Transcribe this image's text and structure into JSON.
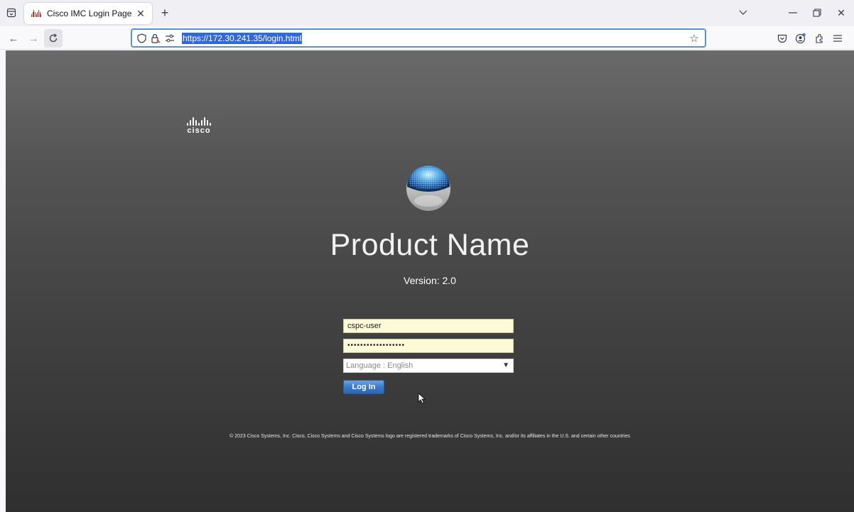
{
  "browser": {
    "tab_title": "Cisco IMC Login Page",
    "url": "https://172.30.241.35/login.html"
  },
  "page": {
    "logo_text": "cisco",
    "product_name": "Product Name",
    "version": "Version: 2.0",
    "username_value": "cspc-user",
    "password_value": "••••••••••••••••••",
    "language_select": "Language : English",
    "login_label": "Log In",
    "footer": "© 2023 Cisco Systems, Inc. Cisco, Cisco Systems and Cisco Systems logo are registered trademarks of Cisco Systems, Inc. and/or its affiliates in the U.S. and certain other countries"
  },
  "colors": {
    "login_button": "#3b78c4",
    "input_background": "#fdfbd7",
    "url_highlight": "#3367d6"
  },
  "icons": [
    "tab-list-icon",
    "cisco-favicon-icon",
    "close-icon",
    "plus-icon",
    "chevron-down-icon",
    "minimize-icon",
    "restore-icon",
    "back-icon",
    "forward-icon",
    "reload-icon",
    "shield-icon",
    "lock-icon",
    "permissions-icon",
    "star-icon",
    "pocket-icon",
    "account-icon",
    "extensions-icon",
    "menu-icon",
    "cisco-logo",
    "product-sphere-icon",
    "cursor-icon"
  ]
}
